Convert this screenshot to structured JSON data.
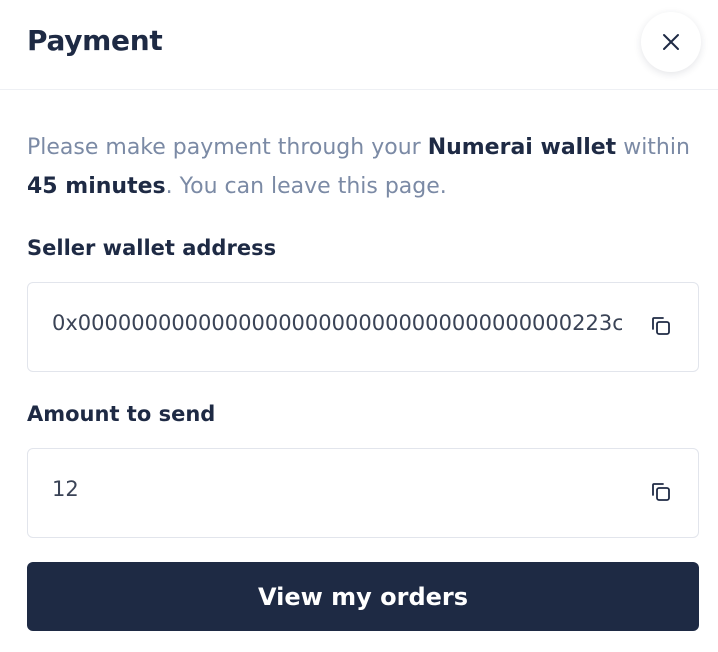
{
  "modal": {
    "title": "Payment",
    "close_icon": "close-icon"
  },
  "instructions": {
    "part1": "Please make payment through your ",
    "wallet": "Numerai wallet",
    "part2": " within ",
    "time": "45 minutes",
    "part3": ". You can leave this page."
  },
  "seller_wallet": {
    "label": "Seller wallet address",
    "value": "0x0000000000000000000000000000000000000223c",
    "copy_icon": "copy-icon"
  },
  "amount": {
    "label": "Amount to send",
    "value": "12",
    "copy_icon": "copy-icon"
  },
  "actions": {
    "view_orders_label": "View my orders"
  }
}
